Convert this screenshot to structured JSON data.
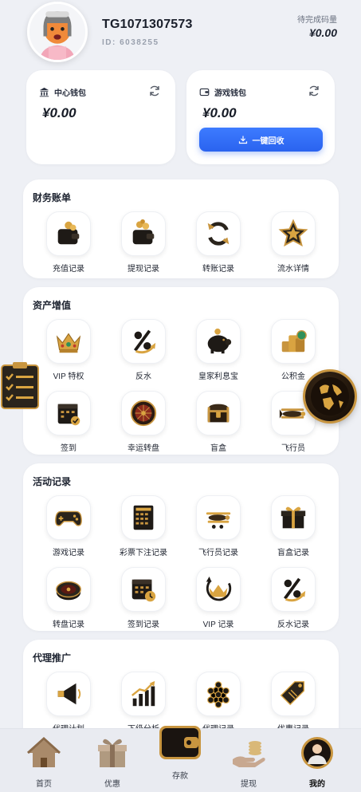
{
  "user": {
    "name": "TG1071307573",
    "id_label": "ID: 6038255"
  },
  "pending": {
    "label": "待完成码量",
    "value": "¥0.00"
  },
  "wallets": {
    "center": {
      "title": "中心钱包",
      "value": "¥0.00"
    },
    "game": {
      "title": "游戏钱包",
      "value": "¥0.00",
      "button": "一键回收"
    }
  },
  "sections": {
    "finance": {
      "title": "财务账单",
      "items": [
        "充值记录",
        "提现记录",
        "转账记录",
        "流水详情"
      ]
    },
    "assets": {
      "title": "资产增值",
      "items": [
        "VIP 特权",
        "反水",
        "皇家利息宝",
        "公积金",
        "签到",
        "幸运转盘",
        "盲盒",
        "飞行员"
      ]
    },
    "activity": {
      "title": "活动记录",
      "items": [
        "游戏记录",
        "彩票下注记录",
        "飞行员记录",
        "盲盒记录",
        "转盘记录",
        "签到记录",
        "VIP 记录",
        "反水记录"
      ]
    },
    "agent": {
      "title": "代理推广",
      "items": [
        "代理计划",
        "下级分析",
        "代理记录",
        "优惠记录"
      ]
    }
  },
  "nav": [
    "首页",
    "优惠",
    "存款",
    "提现",
    "我的"
  ],
  "colors": {
    "accent": "#2a63ef",
    "gold": "#c8953f",
    "background": "#eef0f5"
  }
}
